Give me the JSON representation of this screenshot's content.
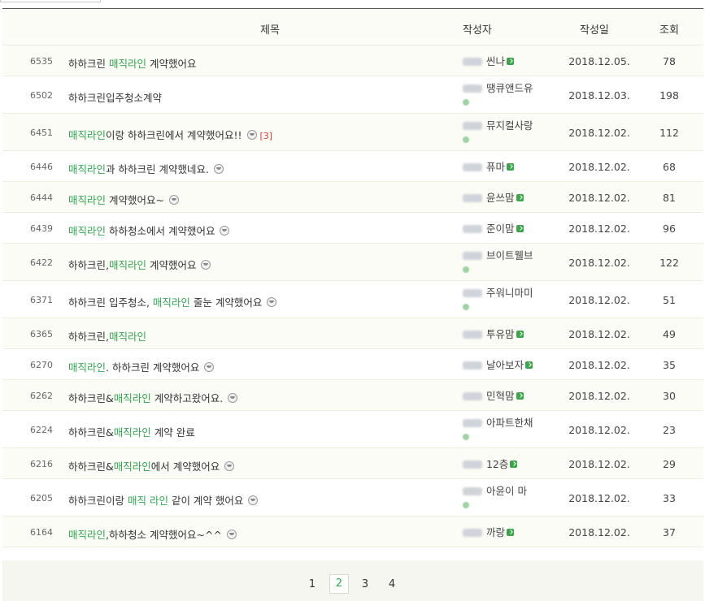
{
  "headers": {
    "title": "제목",
    "author": "작성자",
    "date": "작성일",
    "views": "조회"
  },
  "rows": [
    {
      "num": "6535",
      "title": [
        {
          "t": "하하크린 "
        },
        {
          "t": "매직라인",
          "g": 1
        },
        {
          "t": " 계약했어요"
        }
      ],
      "face": false,
      "comments": "",
      "author": "씬나",
      "author_line2": false,
      "date": "2018.12.05.",
      "views": "78"
    },
    {
      "num": "6502",
      "title": [
        {
          "t": "하하크린입주청소계약"
        }
      ],
      "face": false,
      "comments": "",
      "author": "땡큐앤드유",
      "author_line2": true,
      "date": "2018.12.03.",
      "views": "198"
    },
    {
      "num": "6451",
      "title": [
        {
          "t": "매직라인",
          "g": 1
        },
        {
          "t": "이랑 하하크린에서 계약했어요!!"
        }
      ],
      "face": true,
      "comments": "[3]",
      "author": "뮤지컬사랑",
      "author_line2": true,
      "date": "2018.12.02.",
      "views": "112"
    },
    {
      "num": "6446",
      "title": [
        {
          "t": "매직라인",
          "g": 1
        },
        {
          "t": "과 하하크린 계약했네요."
        }
      ],
      "face": true,
      "comments": "",
      "author": "퓨마",
      "author_line2": false,
      "date": "2018.12.02.",
      "views": "68"
    },
    {
      "num": "6444",
      "title": [
        {
          "t": "매직라인",
          "g": 1
        },
        {
          "t": " 계약했어요~"
        }
      ],
      "face": true,
      "comments": "",
      "author": "윤쓰맘",
      "author_line2": false,
      "date": "2018.12.02.",
      "views": "81"
    },
    {
      "num": "6439",
      "title": [
        {
          "t": "매직라인",
          "g": 1
        },
        {
          "t": " 하하청소에서 계약했어요"
        }
      ],
      "face": true,
      "comments": "",
      "author": "준이맘",
      "author_line2": false,
      "date": "2018.12.02.",
      "views": "96"
    },
    {
      "num": "6422",
      "title": [
        {
          "t": "하하크린,"
        },
        {
          "t": "매직라인",
          "g": 1
        },
        {
          "t": " 계약했어요"
        }
      ],
      "face": true,
      "comments": "",
      "author": "브이트웰브",
      "author_line2": true,
      "date": "2018.12.02.",
      "views": "122"
    },
    {
      "num": "6371",
      "title": [
        {
          "t": "하하크린 입주청소, "
        },
        {
          "t": "매직라인",
          "g": 1
        },
        {
          "t": " 줄눈 계약했어요"
        }
      ],
      "face": true,
      "comments": "",
      "author": "주워니마미",
      "author_line2": true,
      "date": "2018.12.02.",
      "views": "51"
    },
    {
      "num": "6365",
      "title": [
        {
          "t": "하하크린,"
        },
        {
          "t": "매직라인",
          "g": 1
        }
      ],
      "face": false,
      "comments": "",
      "author": "투유맘",
      "author_line2": false,
      "date": "2018.12.02.",
      "views": "49"
    },
    {
      "num": "6270",
      "title": [
        {
          "t": "매직라인",
          "g": 1
        },
        {
          "t": ". 하하크린 계약했어요"
        }
      ],
      "face": true,
      "comments": "",
      "author": "날아보자",
      "author_line2": false,
      "date": "2018.12.02.",
      "views": "35"
    },
    {
      "num": "6262",
      "title": [
        {
          "t": "하하크린&"
        },
        {
          "t": "매직라인",
          "g": 1
        },
        {
          "t": " 계약하고왔어요."
        }
      ],
      "face": true,
      "comments": "",
      "author": "민혁맘",
      "author_line2": false,
      "date": "2018.12.02.",
      "views": "30"
    },
    {
      "num": "6224",
      "title": [
        {
          "t": "하하크린&"
        },
        {
          "t": "매직라인",
          "g": 1
        },
        {
          "t": " 계약 완료"
        }
      ],
      "face": false,
      "comments": "",
      "author": "아파트한채",
      "author_line2": true,
      "date": "2018.12.02.",
      "views": "23"
    },
    {
      "num": "6216",
      "title": [
        {
          "t": "하하크린&"
        },
        {
          "t": "매직라인",
          "g": 1
        },
        {
          "t": "에서 계약했어요"
        }
      ],
      "face": true,
      "comments": "",
      "author": "12층",
      "author_line2": false,
      "date": "2018.12.02.",
      "views": "29"
    },
    {
      "num": "6205",
      "title": [
        {
          "t": "하하크린이랑 "
        },
        {
          "t": "매직 라인",
          "g": 1
        },
        {
          "t": " 같이 계약 했어요"
        }
      ],
      "face": true,
      "comments": "",
      "author": "아윤이 마",
      "author_line2": true,
      "date": "2018.12.02.",
      "views": "33"
    },
    {
      "num": "6164",
      "title": [
        {
          "t": "매직라인",
          "g": 1
        },
        {
          "t": ",하하청소 계약했어요~^^"
        }
      ],
      "face": true,
      "comments": "",
      "author": "까랑",
      "author_line2": false,
      "date": "2018.12.02.",
      "views": "37"
    }
  ],
  "pages": [
    "1",
    "2",
    "3",
    "4"
  ],
  "current_page": "2",
  "colors": {
    "link_green": "#2fa84f",
    "comment_red": "#e03a2f"
  }
}
